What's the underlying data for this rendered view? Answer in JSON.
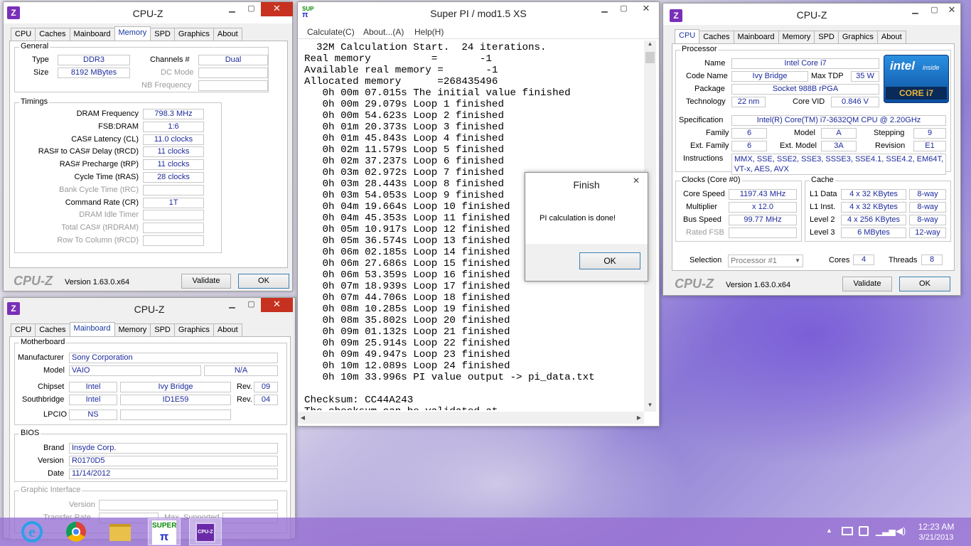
{
  "cpuz_memory": {
    "title": "CPU-Z",
    "tabs": [
      "CPU",
      "Caches",
      "Mainboard",
      "Memory",
      "SPD",
      "Graphics",
      "About"
    ],
    "active_tab": "Memory",
    "general": {
      "label": "General",
      "type_label": "Type",
      "type": "DDR3",
      "size_label": "Size",
      "size": "8192 MBytes",
      "channels_label": "Channels #",
      "channels": "Dual",
      "dc_mode_label": "DC Mode",
      "nb_freq_label": "NB Frequency"
    },
    "timings": {
      "label": "Timings",
      "rows": [
        {
          "label": "DRAM Frequency",
          "value": "798.3 MHz",
          "dim": false
        },
        {
          "label": "FSB:DRAM",
          "value": "1:6",
          "dim": false
        },
        {
          "label": "CAS# Latency (CL)",
          "value": "11.0 clocks",
          "dim": false
        },
        {
          "label": "RAS# to CAS# Delay (tRCD)",
          "value": "11 clocks",
          "dim": false
        },
        {
          "label": "RAS# Precharge (tRP)",
          "value": "11 clocks",
          "dim": false
        },
        {
          "label": "Cycle Time (tRAS)",
          "value": "28 clocks",
          "dim": false
        },
        {
          "label": "Bank Cycle Time (tRC)",
          "value": "",
          "dim": true
        },
        {
          "label": "Command Rate (CR)",
          "value": "1T",
          "dim": false
        },
        {
          "label": "DRAM Idle Timer",
          "value": "",
          "dim": true
        },
        {
          "label": "Total CAS# (tRDRAM)",
          "value": "",
          "dim": true
        },
        {
          "label": "Row To Column (tRCD)",
          "value": "",
          "dim": true
        }
      ]
    },
    "brand": "CPU-Z",
    "version": "Version 1.63.0.x64",
    "validate": "Validate",
    "ok": "OK"
  },
  "cpuz_mainboard": {
    "title": "CPU-Z",
    "tabs": [
      "CPU",
      "Caches",
      "Mainboard",
      "Memory",
      "SPD",
      "Graphics",
      "About"
    ],
    "active_tab": "Mainboard",
    "motherboard": {
      "label": "Motherboard",
      "manufacturer_label": "Manufacturer",
      "manufacturer": "Sony Corporation",
      "model_label": "Model",
      "model": "VAIO",
      "model_rev": "N/A",
      "chipset_label": "Chipset",
      "chipset_vendor": "Intel",
      "chipset_name": "Ivy Bridge",
      "chipset_rev_label": "Rev.",
      "chipset_rev": "09",
      "southbridge_label": "Southbridge",
      "sb_vendor": "Intel",
      "sb_name": "ID1E59",
      "sb_rev_label": "Rev.",
      "sb_rev": "04",
      "lpcio_label": "LPCIO",
      "lpcio": "NS"
    },
    "bios": {
      "label": "BIOS",
      "brand_label": "Brand",
      "brand": "Insyde Corp.",
      "version_label": "Version",
      "version": "R0170D5",
      "date_label": "Date",
      "date": "11/14/2012"
    },
    "graphic": {
      "label": "Graphic Interface",
      "version_label": "Version",
      "transfer_label": "Transfer Rate",
      "max_label": "Max. Supported"
    }
  },
  "superpi": {
    "title": "Super PI / mod1.5 XS",
    "menu": [
      "Calculate(C)",
      "About...(A)",
      "Help(H)"
    ],
    "lines": [
      "  32M Calculation Start.  24 iterations.",
      "Real memory          =       -1",
      "Available real memory =       -1",
      "Allocated memory      =268435496",
      "   0h 00m 07.015s The initial value finished",
      "   0h 00m 29.079s Loop 1 finished",
      "   0h 00m 54.623s Loop 2 finished",
      "   0h 01m 20.373s Loop 3 finished",
      "   0h 01m 45.843s Loop 4 finished",
      "   0h 02m 11.579s Loop 5 finished",
      "   0h 02m 37.237s Loop 6 finished",
      "   0h 03m 02.972s Loop 7 finished",
      "   0h 03m 28.443s Loop 8 finished",
      "   0h 03m 54.053s Loop 9 finished",
      "   0h 04m 19.664s Loop 10 finished",
      "   0h 04m 45.353s Loop 11 finished",
      "   0h 05m 10.917s Loop 12 finished",
      "   0h 05m 36.574s Loop 13 finished",
      "   0h 06m 02.185s Loop 14 finished",
      "   0h 06m 27.686s Loop 15 finished",
      "   0h 06m 53.359s Loop 16 finished",
      "   0h 07m 18.939s Loop 17 finished",
      "   0h 07m 44.706s Loop 18 finished",
      "   0h 08m 10.285s Loop 19 finished",
      "   0h 08m 35.802s Loop 20 finished",
      "   0h 09m 01.132s Loop 21 finished",
      "   0h 09m 25.914s Loop 22 finished",
      "   0h 09m 49.947s Loop 23 finished",
      "   0h 10m 12.089s Loop 24 finished",
      "   0h 10m 33.996s PI value output -> pi_data.txt",
      "",
      "Checksum: CC44A243",
      "The checksum can be validated at"
    ]
  },
  "finish": {
    "title": "Finish",
    "message": "PI calculation is done!",
    "ok": "OK"
  },
  "cpuz_cpu": {
    "title": "CPU-Z",
    "tabs": [
      "CPU",
      "Caches",
      "Mainboard",
      "Memory",
      "SPD",
      "Graphics",
      "About"
    ],
    "active_tab": "CPU",
    "processor": {
      "label": "Processor",
      "name_label": "Name",
      "name": "Intel Core i7",
      "codename_label": "Code Name",
      "codename": "Ivy Bridge",
      "maxtdp_label": "Max TDP",
      "maxtdp": "35 W",
      "package_label": "Package",
      "package": "Socket 988B rPGA",
      "tech_label": "Technology",
      "tech": "22 nm",
      "corevid_label": "Core VID",
      "corevid": "0.846 V",
      "spec_label": "Specification",
      "spec": "Intel(R) Core(TM) i7-3632QM CPU @ 2.20GHz",
      "family_label": "Family",
      "family": "6",
      "model_label": "Model",
      "model": "A",
      "stepping_label": "Stepping",
      "stepping": "9",
      "extfamily_label": "Ext. Family",
      "extfamily": "6",
      "extmodel_label": "Ext. Model",
      "extmodel": "3A",
      "revision_label": "Revision",
      "revision": "E1",
      "instr_label": "Instructions",
      "instr1": "MMX, SSE, SSE2, SSE3, SSSE3, SSE4.1, SSE4.2, EM64T,",
      "instr2": "VT-x, AES, AVX",
      "logo_intel": "intel",
      "logo_inside": "inside",
      "logo_core": "CORE i7"
    },
    "clocks": {
      "label": "Clocks (Core #0)",
      "core_speed_label": "Core Speed",
      "core_speed": "1197.43 MHz",
      "mult_label": "Multiplier",
      "mult": "x 12.0",
      "bus_label": "Bus Speed",
      "bus": "99.77 MHz",
      "rated_label": "Rated FSB"
    },
    "cache": {
      "label": "Cache",
      "rows": [
        {
          "label": "L1 Data",
          "size": "4 x 32 KBytes",
          "way": "8-way"
        },
        {
          "label": "L1 Inst.",
          "size": "4 x 32 KBytes",
          "way": "8-way"
        },
        {
          "label": "Level 2",
          "size": "4 x 256 KBytes",
          "way": "8-way"
        },
        {
          "label": "Level 3",
          "size": "6 MBytes",
          "way": "12-way"
        }
      ]
    },
    "selection_label": "Selection",
    "selection": "Processor #1",
    "cores_label": "Cores",
    "cores": "4",
    "threads_label": "Threads",
    "threads": "8",
    "brand": "CPU-Z",
    "version": "Version 1.63.0.x64",
    "validate": "Validate",
    "ok": "OK"
  },
  "taskbar": {
    "time": "12:23 AM",
    "date": "3/21/2013",
    "superpi_label": "SUPER",
    "cpuz_label": "CPU-Z"
  },
  "colors": {
    "value_text": "#1c2a9c",
    "close_button": "#c7311f",
    "taskbar": "#9670d2",
    "accent_tab": "#1a3aa0"
  }
}
